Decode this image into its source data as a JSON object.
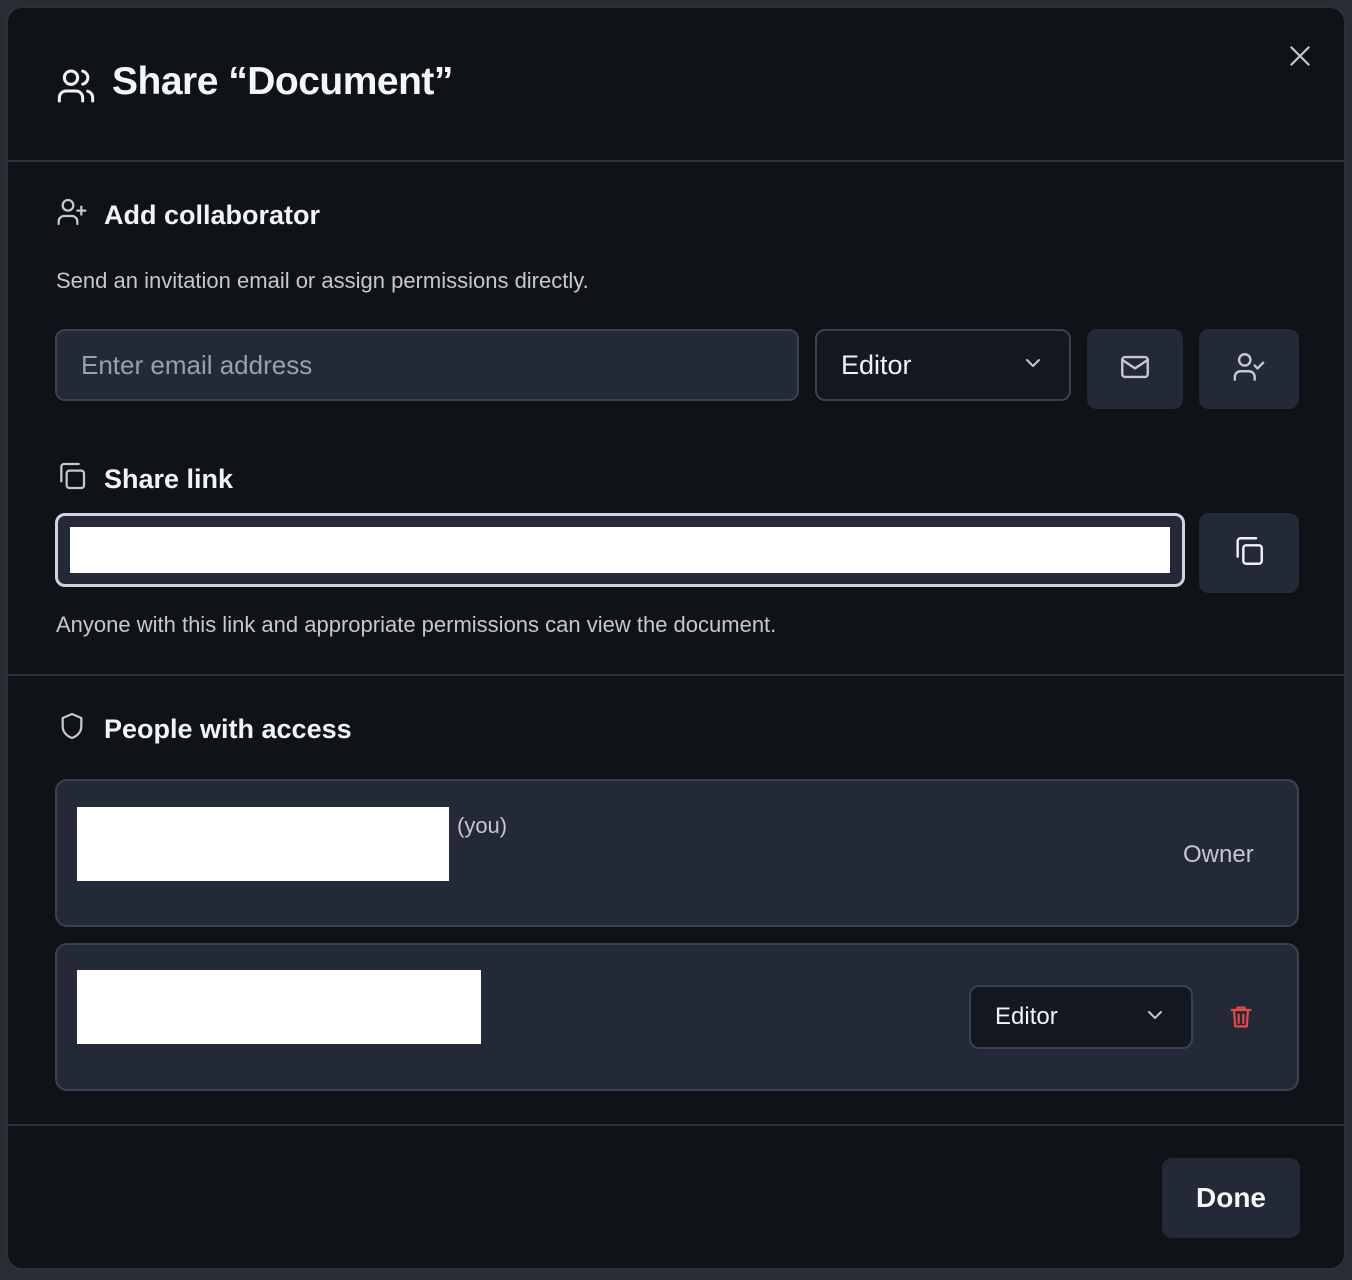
{
  "dialog": {
    "title": "Share “Document”"
  },
  "add_collaborator": {
    "heading": "Add collaborator",
    "description": "Send an invitation email or assign permissions directly.",
    "email_placeholder": "Enter email address",
    "email_value": "",
    "role_selected": "Editor"
  },
  "share_link": {
    "heading": "Share link",
    "note": "Anyone with this link and appropriate permissions can view the document."
  },
  "people": {
    "heading": "People with access",
    "members": [
      {
        "you_label": "(you)",
        "role": "Owner"
      },
      {
        "role": "Editor"
      }
    ]
  },
  "footer": {
    "done_label": "Done"
  },
  "colors": {
    "background": "#0f1217",
    "surface": "#232936",
    "border": "#3a4150",
    "danger": "#e5484d"
  },
  "icons": {
    "title": "users-icon",
    "close": "close-icon",
    "add_collaborator": "user-plus-icon",
    "send_invite": "mail-icon",
    "assign": "user-check-icon",
    "share_link": "copy-icon",
    "copy": "copy-icon",
    "people": "shield-icon",
    "dropdown": "chevron-down-icon",
    "remove": "trash-icon"
  }
}
